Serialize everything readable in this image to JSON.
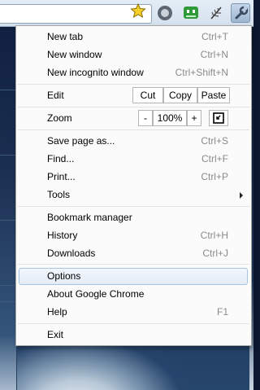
{
  "menu": {
    "new_tab": {
      "label": "New tab",
      "shortcut": "Ctrl+T"
    },
    "new_window": {
      "label": "New window",
      "shortcut": "Ctrl+N"
    },
    "new_incognito": {
      "label": "New incognito window",
      "shortcut": "Ctrl+Shift+N"
    },
    "edit": {
      "label": "Edit",
      "cut": "Cut",
      "copy": "Copy",
      "paste": "Paste"
    },
    "zoom": {
      "label": "Zoom",
      "minus": "-",
      "level": "100%",
      "plus": "+"
    },
    "save_page": {
      "label": "Save page as...",
      "shortcut": "Ctrl+S"
    },
    "find": {
      "label": "Find...",
      "shortcut": "Ctrl+F"
    },
    "print": {
      "label": "Print...",
      "shortcut": "Ctrl+P"
    },
    "tools": {
      "label": "Tools"
    },
    "bookmark_manager": {
      "label": "Bookmark manager"
    },
    "history": {
      "label": "History",
      "shortcut": "Ctrl+H"
    },
    "downloads": {
      "label": "Downloads",
      "shortcut": "Ctrl+J"
    },
    "options": {
      "label": "Options"
    },
    "about": {
      "label": "About Google Chrome"
    },
    "help": {
      "label": "Help",
      "shortcut": "F1"
    },
    "exit": {
      "label": "Exit"
    }
  },
  "toolbar_icons": [
    "star-icon",
    "extension-circle-icon",
    "extension-green-icon",
    "extension-feather-icon",
    "wrench-icon"
  ],
  "colors": {
    "highlight_border": "#a9c3e2",
    "shortcut_text": "#8a8a8a",
    "star_fill": "#f7cf2a"
  }
}
